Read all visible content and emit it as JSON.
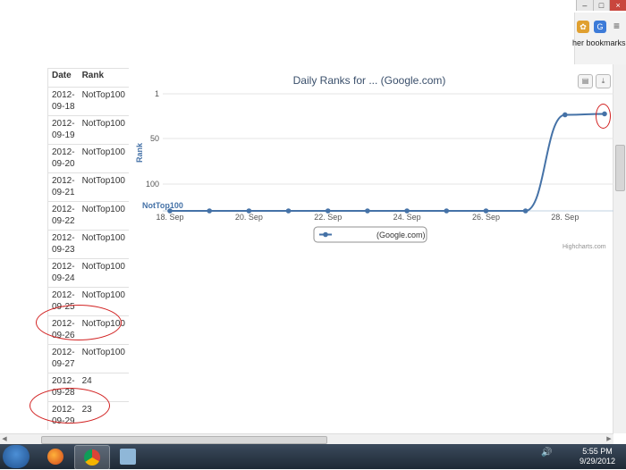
{
  "browser": {
    "bookmarks_label": "her bookmarks",
    "window_controls": [
      "–",
      "□",
      "×"
    ]
  },
  "table": {
    "headers": [
      "Date",
      "Rank"
    ],
    "rows": [
      {
        "date": "2012-09-18",
        "rank": "NotTop100"
      },
      {
        "date": "2012-09-19",
        "rank": "NotTop100"
      },
      {
        "date": "2012-09-20",
        "rank": "NotTop100"
      },
      {
        "date": "2012-09-21",
        "rank": "NotTop100"
      },
      {
        "date": "2012-09-22",
        "rank": "NotTop100"
      },
      {
        "date": "2012-09-23",
        "rank": "NotTop100"
      },
      {
        "date": "2012-09-24",
        "rank": "NotTop100"
      },
      {
        "date": "2012-09-25",
        "rank": "NotTop100"
      },
      {
        "date": "2012-09-26",
        "rank": "NotTop100"
      },
      {
        "date": "2012-09-27",
        "rank": "NotTop100"
      },
      {
        "date": "2012-09-28",
        "rank": "24"
      },
      {
        "date": "2012-09-29",
        "rank": "23"
      }
    ]
  },
  "chart": {
    "title": "Daily Ranks for ... (Google.com)",
    "credit": "Highcharts.com",
    "accent": "#4572a7",
    "icons": [
      "print-icon",
      "download-icon"
    ]
  },
  "chart_data": {
    "type": "line",
    "title": "Daily Ranks for ... (Google.com)",
    "ylabel": "Rank",
    "y_reversed": true,
    "yticks": [
      "1",
      "50",
      "100",
      "NotTop100"
    ],
    "xticks": [
      "18. Sep",
      "20. Sep",
      "22. Sep",
      "24. Sep",
      "26. Sep",
      "28. Sep"
    ],
    "x": [
      "2012-09-18",
      "2012-09-19",
      "2012-09-20",
      "2012-09-21",
      "2012-09-22",
      "2012-09-23",
      "2012-09-24",
      "2012-09-25",
      "2012-09-26",
      "2012-09-27",
      "2012-09-28",
      "2012-09-29"
    ],
    "series": [
      {
        "name": "(Google.com)",
        "values": [
          "NotTop100",
          "NotTop100",
          "NotTop100",
          "NotTop100",
          "NotTop100",
          "NotTop100",
          "NotTop100",
          "NotTop100",
          "NotTop100",
          "NotTop100",
          24,
          23
        ]
      }
    ],
    "legend": "bottom-center",
    "grid": true
  },
  "taskbar": {
    "time": "5:55 PM",
    "date": "9/29/2012"
  }
}
